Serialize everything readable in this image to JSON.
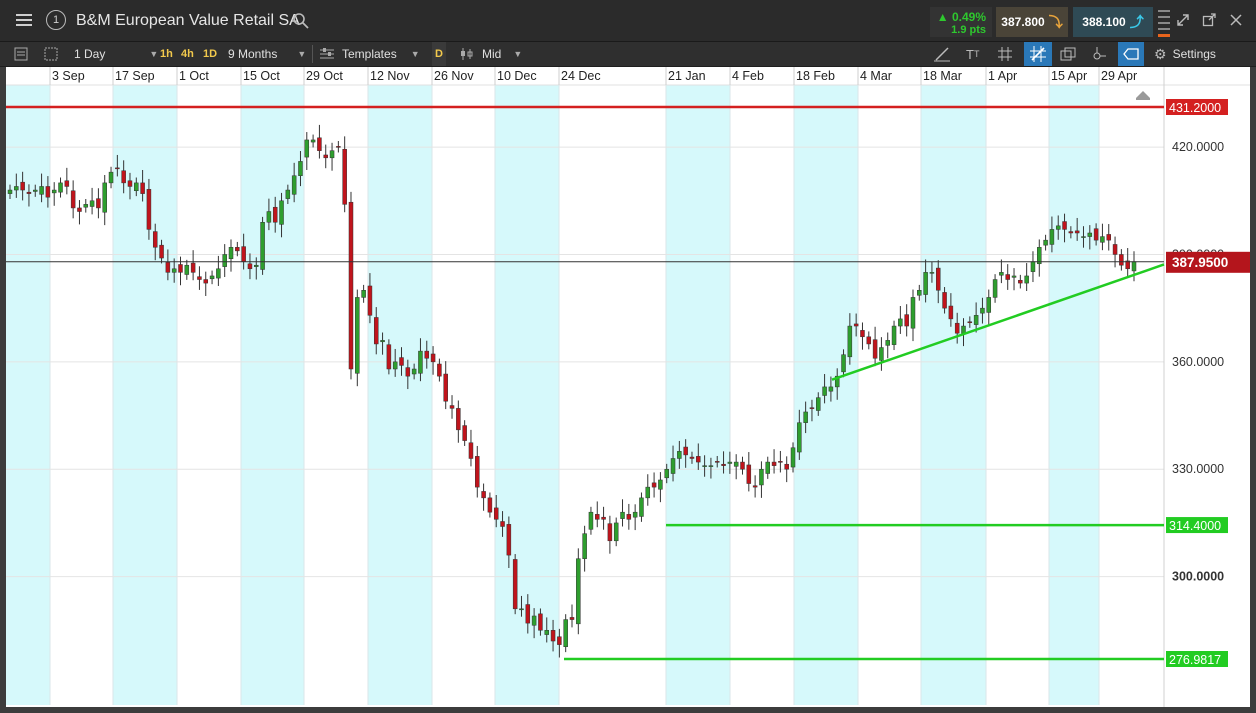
{
  "title_bar": {
    "instrument": "B&M European Value Retail SA",
    "change_pct": "▲ 0.49%",
    "change_pts": "1.9 pts",
    "sell_price": "387.800",
    "buy_price": "388.100",
    "menu_icon": "hamburger-icon",
    "info_icon": "info-circle-icon",
    "info_label": "1"
  },
  "toolbar": {
    "interval": "1 Day",
    "tf_1h": "1h",
    "tf_4h": "4h",
    "tf_1d": "1D",
    "range": "9 Months",
    "templates": "Templates",
    "d_label": "D",
    "price_type": "Mid",
    "settings": "Settings"
  },
  "colors": {
    "up": "#2e9e2e",
    "down": "#c0141c",
    "resistance": "#d42020",
    "support": "#22cc22",
    "band": "#d6f9fb"
  },
  "chart_data": {
    "type": "candlestick",
    "x_ticks": [
      "3 Sep",
      "17 Sep",
      "1 Oct",
      "15 Oct",
      "29 Oct",
      "12 Nov",
      "26 Nov",
      "10 Dec",
      "24 Dec",
      "21 Jan",
      "4 Feb",
      "18 Feb",
      "4 Mar",
      "18 Mar",
      "1 Apr",
      "15 Apr",
      "29 Apr"
    ],
    "y_ticks": [
      "420.0000",
      "390.0000",
      "360.0000",
      "330.0000",
      "300.0000"
    ],
    "ylim": [
      260,
      437
    ],
    "current_price": "387.9500",
    "levels": [
      {
        "label": "431.2000",
        "value": 431.2,
        "kind": "resistance",
        "from": "start"
      },
      {
        "label": "314.4000",
        "value": 314.4,
        "kind": "support",
        "from": "21 Jan"
      },
      {
        "label": "276.9817",
        "value": 276.98,
        "kind": "support",
        "from": "24 Dec"
      }
    ],
    "trendline": {
      "from": {
        "date": "18 Feb",
        "value": 355
      },
      "to": {
        "date": "end",
        "value": 387.2
      }
    },
    "closes": [
      408,
      409,
      408,
      407,
      408,
      409,
      406,
      408,
      410,
      409,
      403,
      402,
      404,
      405,
      403,
      410,
      413,
      414,
      410,
      409,
      410,
      407,
      397,
      392,
      389,
      385,
      386,
      385,
      387,
      385,
      383,
      382,
      384,
      386,
      390,
      392,
      391,
      388,
      386,
      387,
      399,
      402,
      399,
      405,
      408,
      412,
      416,
      422,
      422,
      419,
      417,
      419,
      420,
      404,
      358,
      378,
      380,
      373,
      365,
      366,
      358,
      360,
      359,
      356,
      358,
      363,
      361,
      360,
      356,
      349,
      347,
      341,
      338,
      333,
      325,
      322,
      318,
      316,
      314,
      306,
      291,
      291,
      287,
      289,
      285,
      285,
      282,
      281,
      288,
      288,
      305,
      312,
      318,
      316,
      316,
      310,
      315,
      318,
      316,
      318,
      322,
      325,
      325,
      327,
      330,
      333,
      335,
      334,
      333,
      332,
      331,
      331,
      332,
      331,
      332,
      332,
      330,
      326,
      325,
      330,
      332,
      331,
      332,
      330,
      336,
      343,
      346,
      347,
      350,
      353,
      353,
      356,
      362,
      370,
      370,
      367,
      365,
      361,
      364,
      366,
      370,
      372,
      370,
      378,
      380,
      385,
      385,
      380,
      375,
      372,
      368,
      370,
      371,
      373,
      375,
      378,
      383,
      385,
      383,
      384,
      382,
      384,
      388,
      392,
      394,
      397,
      398,
      397,
      396,
      396,
      395,
      396,
      394,
      395,
      394,
      390,
      387,
      386,
      388
    ]
  }
}
